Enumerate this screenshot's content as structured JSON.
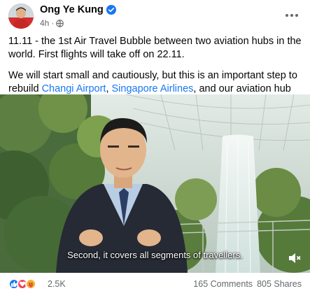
{
  "post": {
    "author": "Ong Ye Kung",
    "time": "4h",
    "paragraph1": "11.11 - the 1st Air Travel Bubble between two aviation hubs in the world. First flights will take off on 22.11.",
    "paragraph2_start": "We will start small and cautiously, but this is an important step to rebuild ",
    "link1": "Changi Airport",
    "sep1": ", ",
    "link2": "Singapore Airlines",
    "paragraph2_end": ", and our aviation hub status."
  },
  "video": {
    "subtitle": "Second, it covers all segments of travellers."
  },
  "footer": {
    "reaction_count": "2.5K",
    "comments": "165 Comments",
    "shares": "805 Shares"
  },
  "icons": {
    "verified": "verified-badge-icon",
    "globe": "globe-icon",
    "more": "more-options-icon",
    "mute": "volume-muted-icon",
    "like": "like-reaction-icon",
    "love": "love-reaction-icon",
    "care": "care-reaction-icon"
  },
  "colors": {
    "brand_blue": "#1877f2",
    "secondary_text": "#65676b",
    "text": "#050505"
  }
}
